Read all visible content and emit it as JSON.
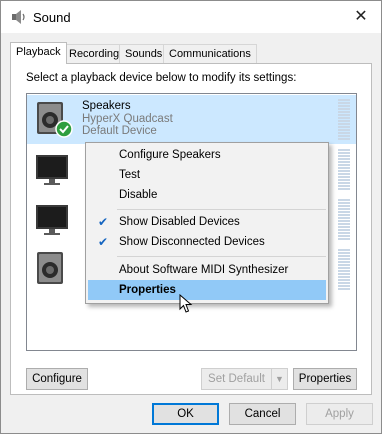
{
  "window": {
    "title": "Sound",
    "title_icon": "speaker-icon",
    "close_glyph": "✕"
  },
  "tabs": [
    {
      "label": "Playback",
      "active": true
    },
    {
      "label": "Recording",
      "active": false
    },
    {
      "label": "Sounds",
      "active": false
    },
    {
      "label": "Communications",
      "active": false
    }
  ],
  "panel": {
    "instruction": "Select a playback device below to modify its settings:"
  },
  "devices": [
    {
      "name": "Speakers",
      "sub": "HyperX Quadcast",
      "status": "Default Device",
      "icon": "speaker-with-check-icon",
      "selected": true
    },
    {
      "name": "",
      "sub": "",
      "status": "",
      "icon": "monitor-icon",
      "selected": false
    },
    {
      "name": "",
      "sub": "",
      "status": "",
      "icon": "monitor-icon",
      "selected": false
    },
    {
      "name": "",
      "sub": "",
      "status": "",
      "icon": "speaker-icon",
      "selected": false
    }
  ],
  "context_menu": {
    "items": [
      {
        "label": "Configure Speakers",
        "checked": false,
        "bold": false
      },
      {
        "label": "Test",
        "checked": false,
        "bold": false
      },
      {
        "label": "Disable",
        "checked": false,
        "bold": false
      },
      {
        "label": "Show Disabled Devices",
        "checked": true,
        "bold": false
      },
      {
        "label": "Show Disconnected Devices",
        "checked": true,
        "bold": false
      },
      {
        "label": "About Software MIDI Synthesizer",
        "checked": false,
        "bold": false
      },
      {
        "label": "Properties",
        "checked": false,
        "bold": true,
        "highlighted": true
      }
    ],
    "check_glyph": "✔"
  },
  "buttons": {
    "configure": "Configure",
    "set_default": "Set Default",
    "set_default_arrow": "▼",
    "properties": "Properties",
    "ok": "OK",
    "cancel": "Cancel",
    "apply": "Apply"
  },
  "colors": {
    "selection": "#cce8ff",
    "menu_highlight": "#91c9f7",
    "check": "#1565c0",
    "default_button_border": "#0078d7",
    "default_device_badge": "#2e9e3e"
  }
}
